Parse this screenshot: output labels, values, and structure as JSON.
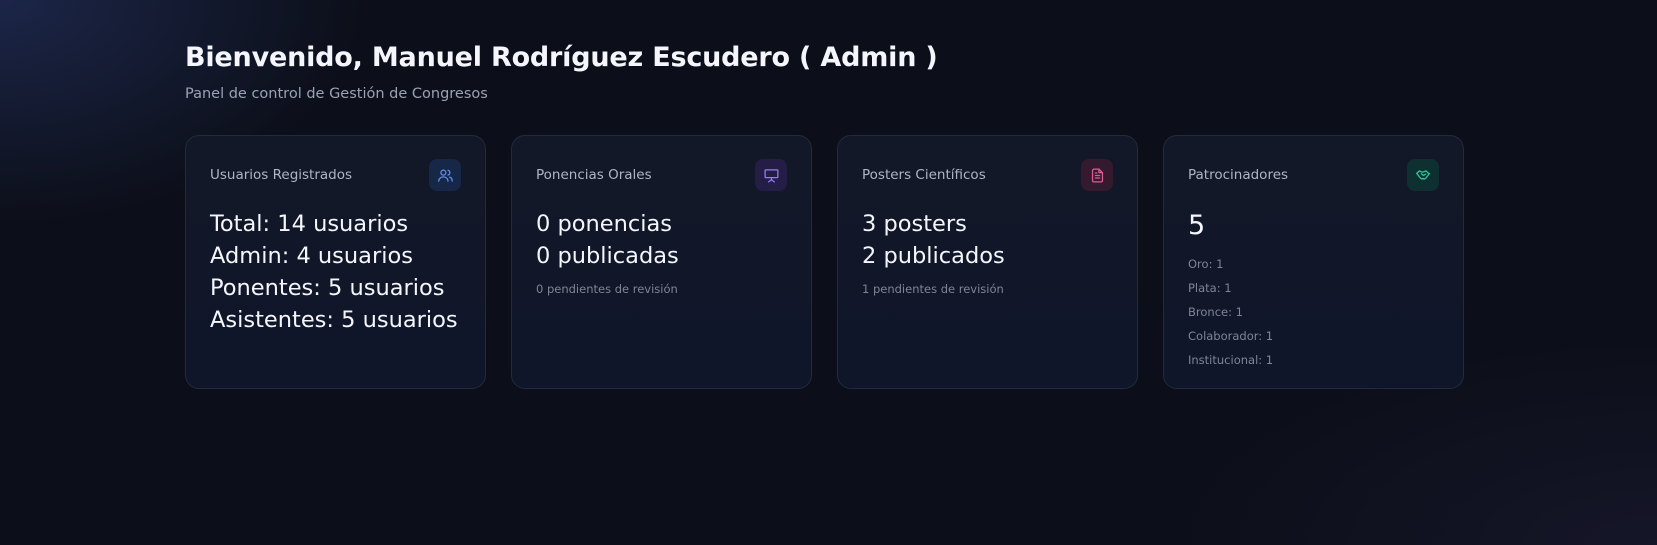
{
  "header": {
    "title": "Bienvenido, Manuel Rodríguez Escudero ( Admin )",
    "subtitle": "Panel de control de Gestión de Congresos"
  },
  "cards": {
    "users": {
      "title": "Usuarios Registrados",
      "icon": "users-icon",
      "accent": "#5b8cf5",
      "lines": [
        "Total: 14 usuarios",
        "Admin: 4 usuarios",
        "Ponentes: 5 usuarios",
        "Asistentes: 5 usuarios"
      ]
    },
    "talks": {
      "title": "Ponencias Orales",
      "icon": "presentation-icon",
      "accent": "#9a7af5",
      "lines": [
        "0 ponencias",
        "0 publicadas"
      ],
      "note": "0 pendientes de revisión"
    },
    "posters": {
      "title": "Posters Científicos",
      "icon": "document-icon",
      "accent": "#e25a95",
      "lines": [
        "3 posters",
        "2 publicados"
      ],
      "note": "1 pendientes de revisión"
    },
    "sponsors": {
      "title": "Patrocinadores",
      "icon": "handshake-icon",
      "accent": "#2fc89a",
      "total": "5",
      "tiers": [
        "Oro: 1",
        "Plata: 1",
        "Bronce: 1",
        "Colaborador: 1",
        "Institucional: 1"
      ]
    }
  }
}
